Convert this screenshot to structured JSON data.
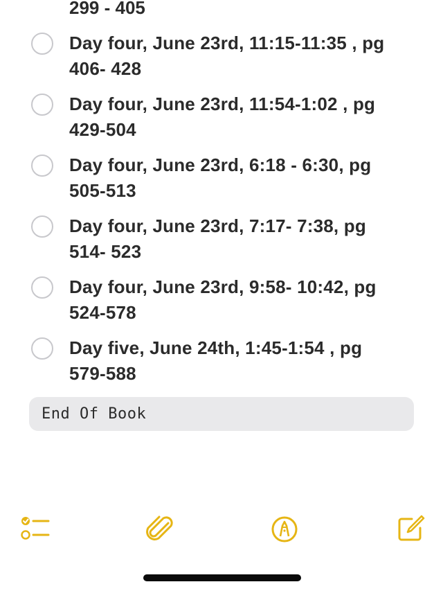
{
  "note": {
    "partial_line": "299 - 405",
    "items": [
      {
        "line1": "Day four, June 23rd, 11:15-11:35 , pg",
        "line2": "406- 428",
        "checked": false
      },
      {
        "line1": "Day four, June 23rd, 11:54-1:02 , pg",
        "line2": "429-504",
        "checked": false
      },
      {
        "line1": "Day four, June 23rd, 6:18 - 6:30, pg",
        "line2": "505-513",
        "checked": false
      },
      {
        "line1": "Day four, June 23rd, 7:17- 7:38, pg",
        "line2": "514- 523",
        "checked": false
      },
      {
        "line1": "Day four, June 23rd, 9:58- 10:42, pg",
        "line2": "524-578",
        "checked": false
      },
      {
        "line1": "Day five, June 24th, 1:45-1:54 , pg",
        "line2": "579-588",
        "checked": false
      }
    ],
    "code_block": "End Of Book"
  },
  "toolbar": {
    "accent_color": "#e6b514",
    "icons": [
      "checklist-icon",
      "paperclip-icon",
      "markup-pen-icon",
      "compose-icon"
    ]
  }
}
